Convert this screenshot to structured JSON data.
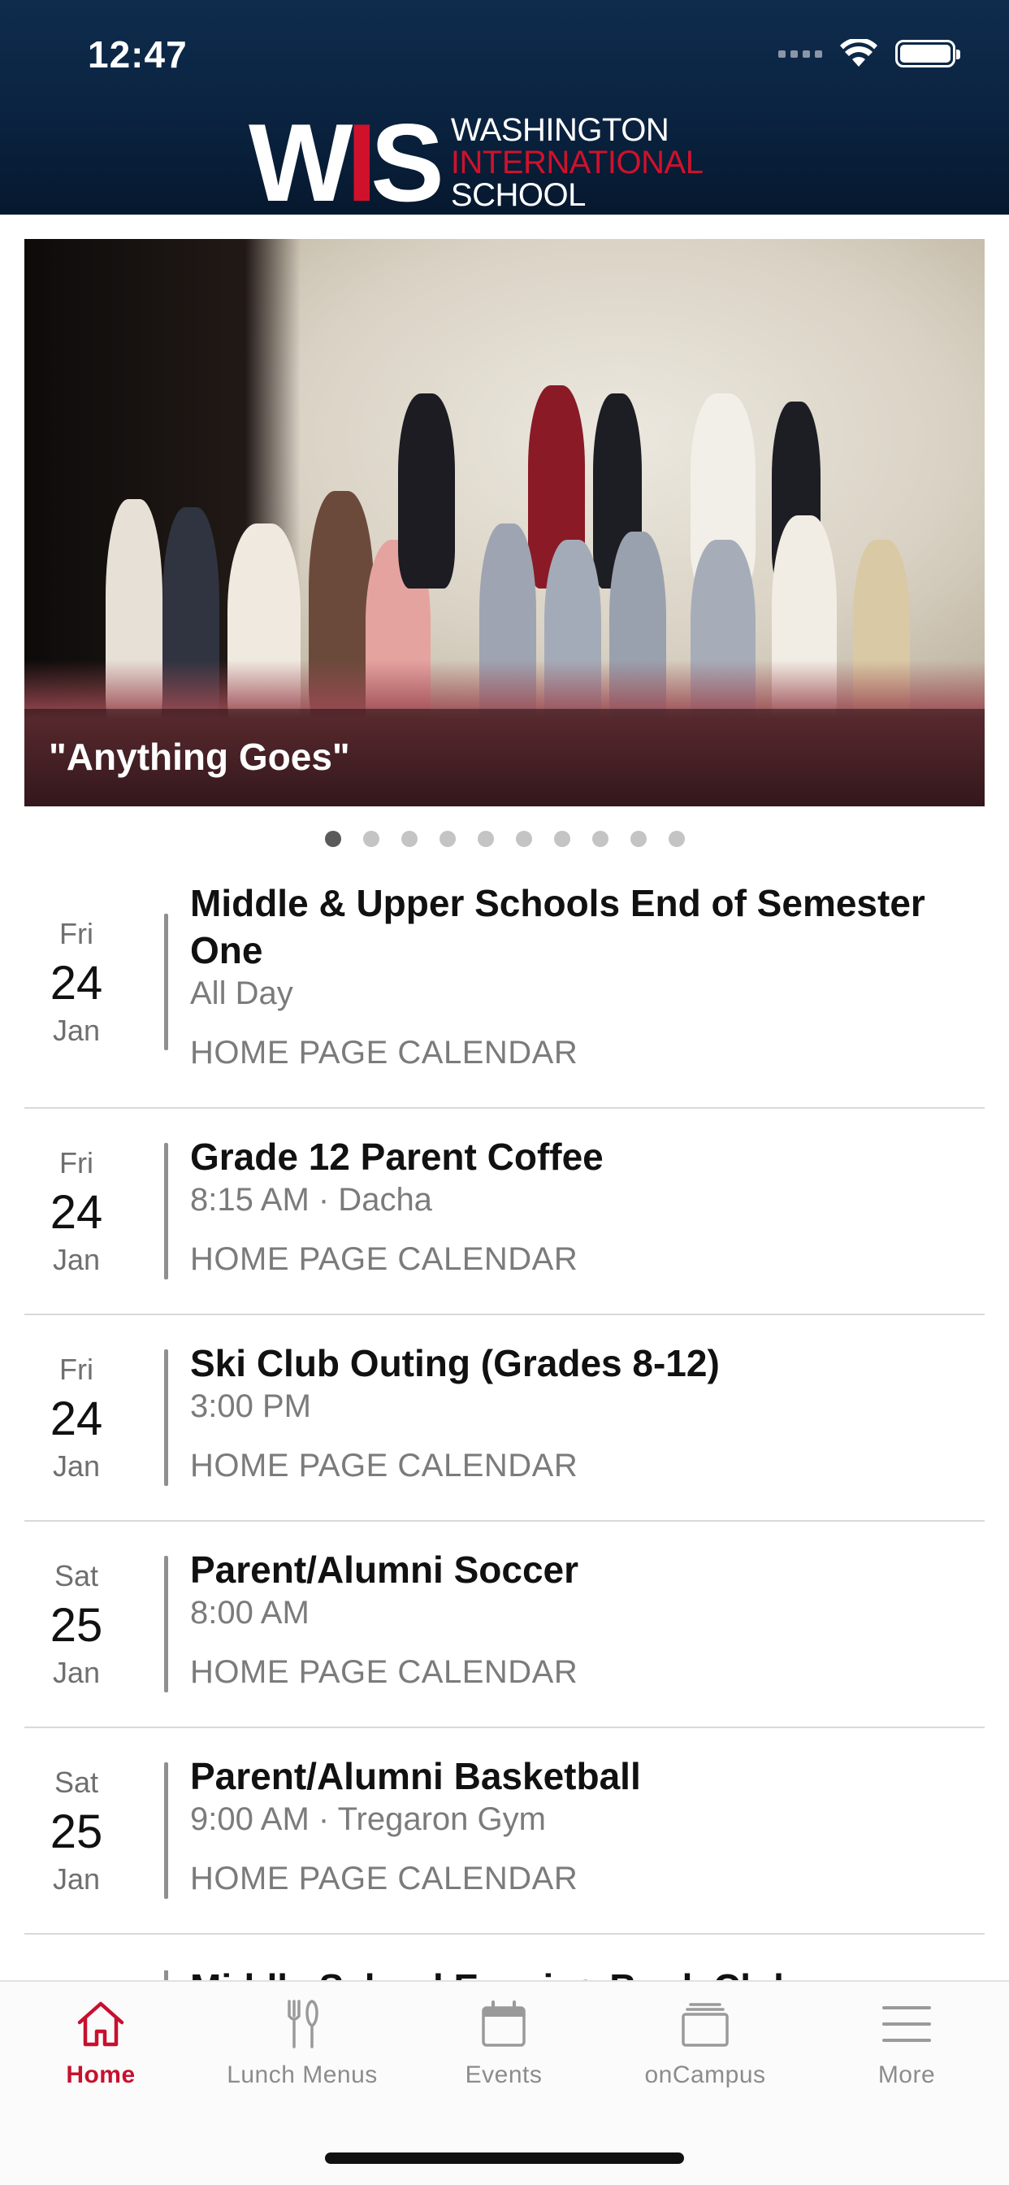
{
  "status_bar": {
    "time": "12:47"
  },
  "logo": {
    "mark": "WIS",
    "line1": "WASHINGTON",
    "line2": "INTERNATIONAL",
    "line3": "SCHOOL"
  },
  "colors": {
    "header_navy": "#0a2340",
    "brand_red": "#d0112b",
    "active_tab": "#c8102e"
  },
  "carousel": {
    "caption": "\"Anything Goes\"",
    "slide_count": 10,
    "active_index": 1
  },
  "events": [
    {
      "dow": "Fri",
      "day": "24",
      "month": "Jan",
      "title": "Middle & Upper Schools End of Semester One",
      "time": "All Day",
      "calendar": "HOME PAGE CALENDAR"
    },
    {
      "dow": "Fri",
      "day": "24",
      "month": "Jan",
      "title": "Grade 12 Parent Coffee",
      "time": "8:15 AM · Dacha",
      "calendar": "HOME PAGE CALENDAR"
    },
    {
      "dow": "Fri",
      "day": "24",
      "month": "Jan",
      "title": "Ski Club Outing (Grades 8-12)",
      "time": "3:00 PM",
      "calendar": "HOME PAGE CALENDAR"
    },
    {
      "dow": "Sat",
      "day": "25",
      "month": "Jan",
      "title": "Parent/Alumni Soccer",
      "time": "8:00 AM",
      "calendar": "HOME PAGE CALENDAR"
    },
    {
      "dow": "Sat",
      "day": "25",
      "month": "Jan",
      "title": "Parent/Alumni Basketball",
      "time": "9:00 AM · Tregaron Gym",
      "calendar": "HOME PAGE CALENDAR"
    }
  ],
  "partial_event": {
    "title": "Middle School Evening Book Club"
  },
  "tabs": [
    {
      "label": "Home",
      "icon": "home-icon",
      "active": true
    },
    {
      "label": "Lunch Menus",
      "icon": "fork-knife-icon",
      "active": false
    },
    {
      "label": "Events",
      "icon": "calendar-icon",
      "active": false
    },
    {
      "label": "onCampus",
      "icon": "stack-icon",
      "active": false
    },
    {
      "label": "More",
      "icon": "menu-icon",
      "active": false
    }
  ]
}
